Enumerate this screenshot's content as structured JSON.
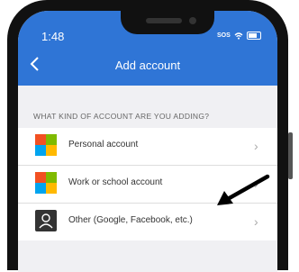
{
  "status": {
    "time": "1:48",
    "network": "SOS"
  },
  "header": {
    "title": "Add account",
    "back_icon": "chevron-left-icon"
  },
  "section_label": "WHAT KIND OF ACCOUNT ARE YOU ADDING?",
  "accounts": [
    {
      "label": "Personal account",
      "icon": "microsoft-logo-icon"
    },
    {
      "label": "Work or school account",
      "icon": "microsoft-logo-icon"
    },
    {
      "label": "Other (Google, Facebook, etc.)",
      "icon": "person-icon"
    }
  ],
  "colors": {
    "header": "#2f75d6",
    "background": "#f0f0f3",
    "arrow": "#000000"
  }
}
